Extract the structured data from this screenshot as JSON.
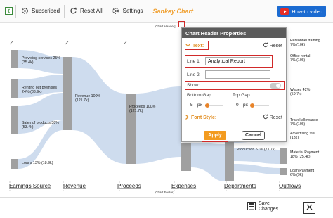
{
  "toolbar": {
    "subscribed_label": "Subscribed",
    "reset_all_label": "Reset All",
    "settings_label": "Settings",
    "chart_name": "Sankey Chart",
    "howto_label": "How-to video"
  },
  "chart": {
    "header_placeholder": "[Chart Header]",
    "footer_placeholder": "[Chart Footer]",
    "axis_labels": [
      "Earnings Source",
      "Revenue",
      "Proceeds",
      "Expenses",
      "Departments",
      "Outflows"
    ],
    "nodes": {
      "providing_services": [
        "Providing services 25%",
        "(35.4k)"
      ],
      "renting": [
        "Renting out premises",
        "24% (33.9k)"
      ],
      "sales": [
        "Sales of products 38%",
        "(53.4k)"
      ],
      "loans": [
        "Loans 13% (18.9k)"
      ],
      "revenue": [
        "Revenue 100%",
        "(121.7k)"
      ],
      "proceeds": [
        "Proceeds 100%",
        "(121.7k)"
      ],
      "production": [
        "Production 51% (71.7k)"
      ],
      "personnel": [
        "Personnel training",
        "7% (10k)"
      ],
      "office_rental": [
        "Office rental",
        "7% (10k)"
      ],
      "wages": [
        "Wages 42%",
        "(59.7k)"
      ],
      "travel": [
        "Travel allowance",
        "7% (10k)"
      ],
      "advertising": [
        "Advertising 9%",
        "(13k)"
      ],
      "material": [
        "Material Payment",
        "18% (25.4k)"
      ],
      "loan_payment": [
        "Loan Payment",
        "6% (9k)"
      ]
    },
    "chart_colors": {
      "node": "#a0a0a0",
      "flow": "#c6d6ec"
    }
  },
  "modal": {
    "title": "Chart Header Properties",
    "text_section": "Text:",
    "reset_label": "Reset",
    "line1_label": "Line 1:",
    "line1_value": "Analytical Report",
    "line2_label": "Line 2:",
    "line2_value": "",
    "show_label": "Show:",
    "show_enabled": false,
    "bottom_gap_label": "Bottom Gap",
    "top_gap_label": "Top Gap",
    "bottom_gap_value": "5",
    "top_gap_value": "0",
    "unit": "px",
    "font_style_label": "Font Style:",
    "apply_label": "Apply",
    "cancel_label": "Cancel",
    "accent_color": "#e29128",
    "highlight_color": "#d12a2a"
  },
  "footer": {
    "save_label_1": "Save",
    "save_label_2": "Changes"
  }
}
